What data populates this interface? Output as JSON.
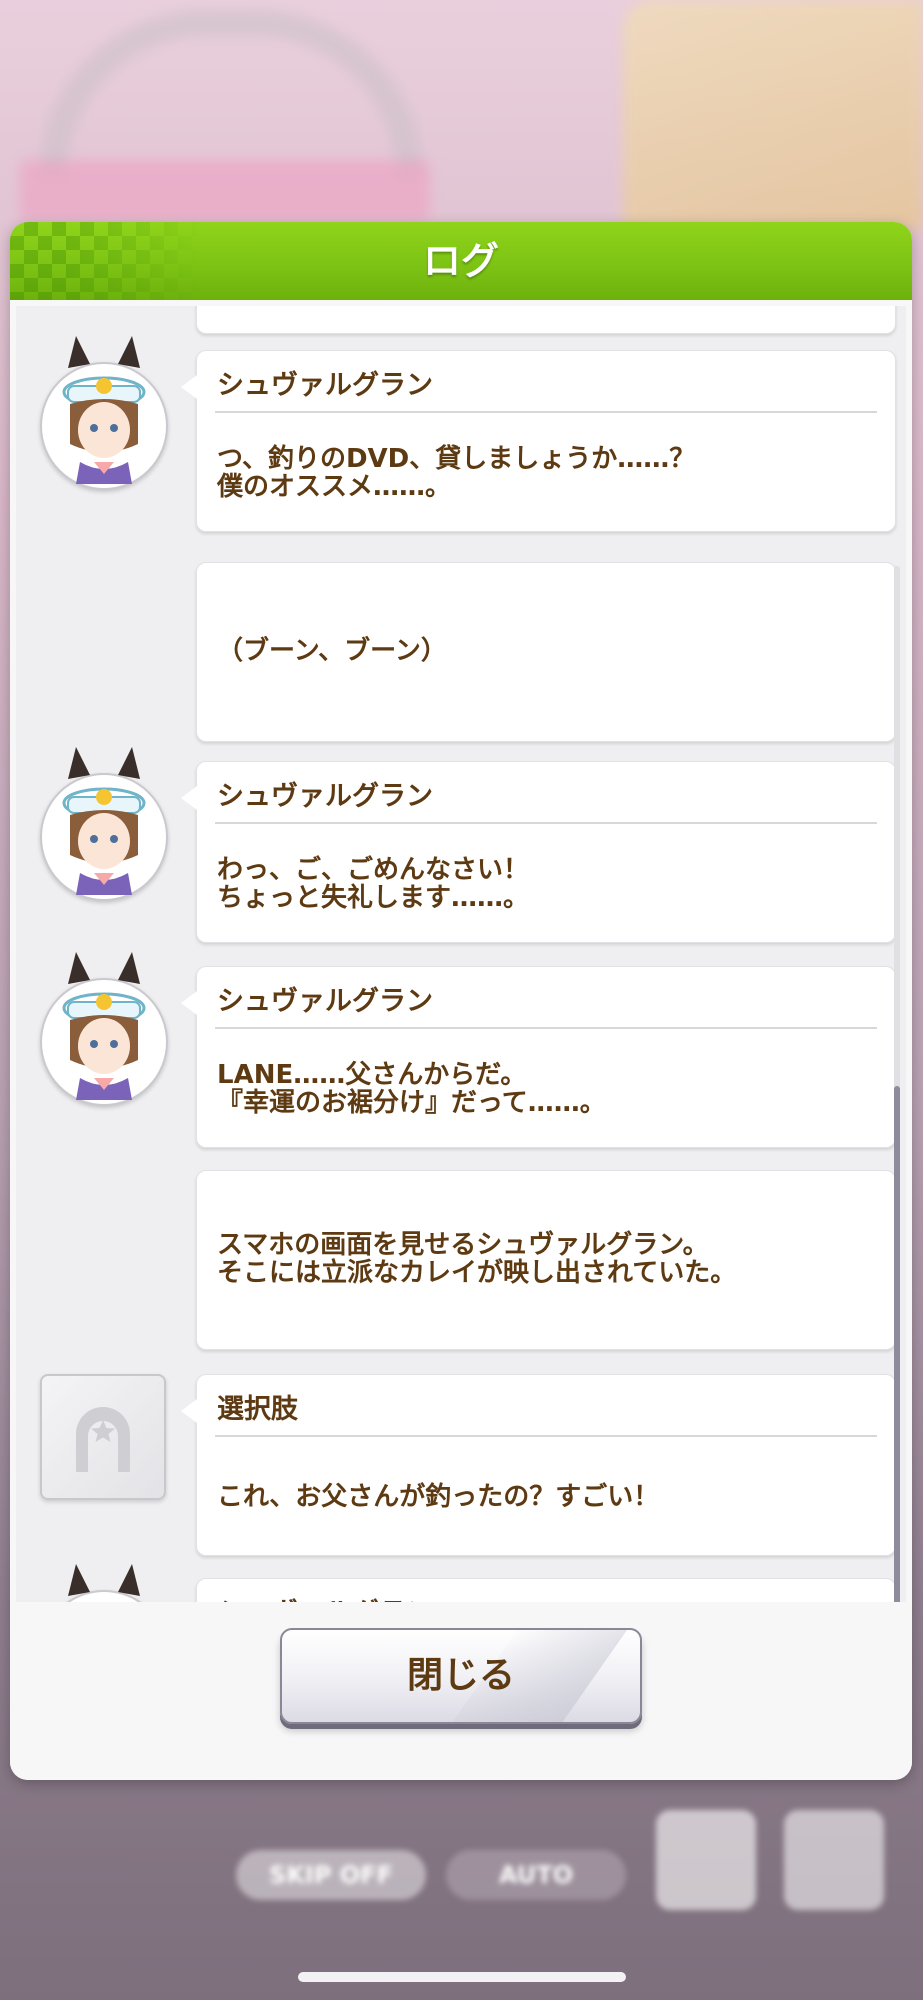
{
  "background": {
    "skip_label": "SKIP OFF",
    "auto_label": "AUTO"
  },
  "dialog": {
    "title": "ログ",
    "close_label": "閉じる"
  },
  "entries": [
    {
      "type": "speech",
      "speaker": "シュヴァルグラン",
      "text": "つ、釣りのDVD、貸しましょうか……？\n僕のオススメ……。"
    },
    {
      "type": "narration",
      "speaker": "",
      "text": "（ブーン、ブーン）"
    },
    {
      "type": "speech",
      "speaker": "シュヴァルグラン",
      "text": "わっ、ご、ごめんなさい！\nちょっと失礼します……。"
    },
    {
      "type": "speech",
      "speaker": "シュヴァルグラン",
      "text": "LANE……父さんからだ。\n『幸運のお裾分け』だって……。"
    },
    {
      "type": "narration",
      "speaker": "",
      "text": "スマホの画面を見せるシュヴァルグラン。\nそこには立派なカレイが映し出されていた。"
    },
    {
      "type": "choice",
      "speaker": "選択肢",
      "text": "これ、お父さんが釣ったの？すごい！"
    },
    {
      "type": "speech",
      "speaker": "シュヴァルグラン",
      "text": ""
    }
  ],
  "colors": {
    "header_green": "#7cc214",
    "text_brown": "#5e3a12"
  }
}
